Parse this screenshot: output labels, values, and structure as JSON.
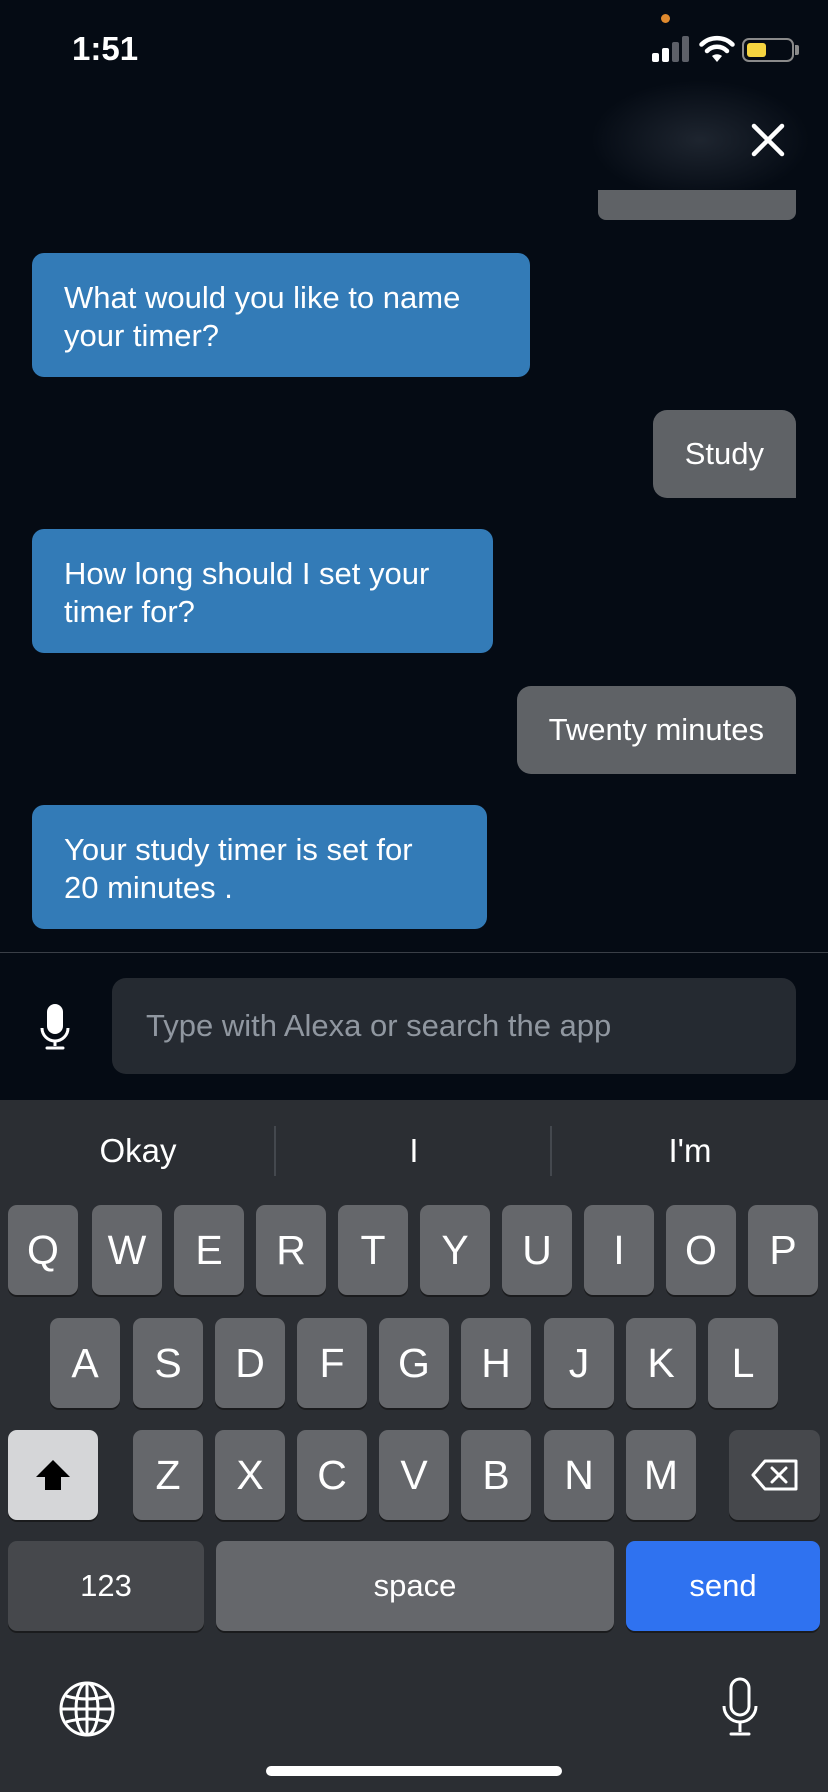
{
  "status_bar": {
    "time": "1:51",
    "icons": [
      "signal-icon",
      "wifi-icon",
      "battery-icon"
    ]
  },
  "header": {
    "close_icon": "close-icon"
  },
  "chat": {
    "messages": [
      {
        "sender": "alexa",
        "text": "What would you like to name your timer?"
      },
      {
        "sender": "user",
        "text": "Study"
      },
      {
        "sender": "alexa",
        "text": "How long should I set your timer for?"
      },
      {
        "sender": "user",
        "text": "Twenty minutes"
      },
      {
        "sender": "alexa",
        "text": "Your study timer is set for 20 minutes ."
      }
    ]
  },
  "input": {
    "placeholder": "Type with Alexa or search the app",
    "value": "",
    "mic_icon": "microphone-icon"
  },
  "keyboard": {
    "suggestions": [
      "Okay",
      "I",
      "I'm"
    ],
    "row1": [
      "Q",
      "W",
      "E",
      "R",
      "T",
      "Y",
      "U",
      "I",
      "O",
      "P"
    ],
    "row2": [
      "A",
      "S",
      "D",
      "F",
      "G",
      "H",
      "J",
      "K",
      "L"
    ],
    "row3": [
      "Z",
      "X",
      "C",
      "V",
      "B",
      "N",
      "M"
    ],
    "numbers_label": "123",
    "space_label": "space",
    "send_label": "send",
    "shift_icon": "shift-icon",
    "backspace_icon": "backspace-icon",
    "globe_icon": "globe-icon",
    "dictation_icon": "microphone-icon"
  },
  "colors": {
    "background": "#050b14",
    "alexa_bubble": "#337bb7",
    "user_bubble": "#5f6266",
    "send_key": "#2f72f0"
  }
}
